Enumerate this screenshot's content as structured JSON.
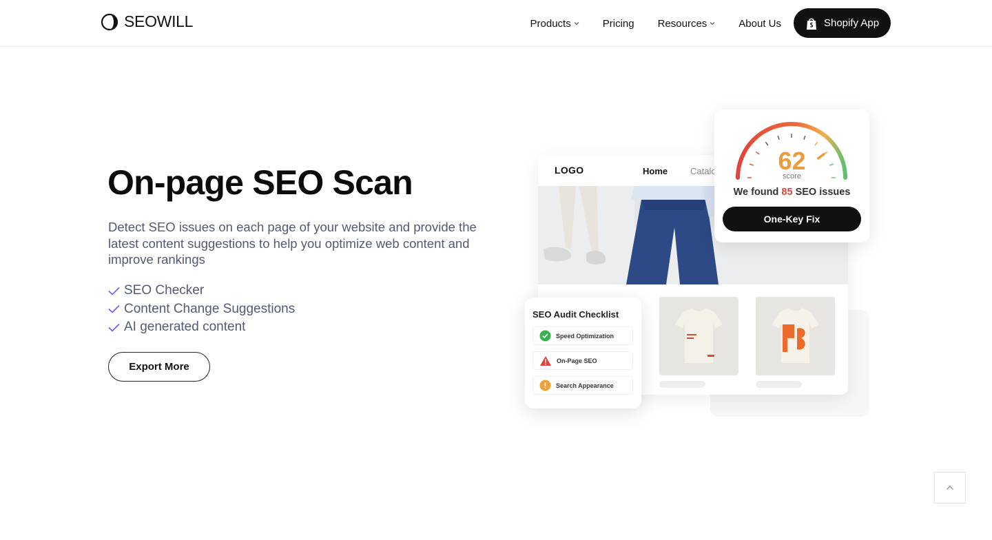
{
  "header": {
    "brand": "SEOWILL",
    "nav": [
      {
        "label": "Products",
        "has_dropdown": true
      },
      {
        "label": "Pricing",
        "has_dropdown": false
      },
      {
        "label": "Resources",
        "has_dropdown": true
      },
      {
        "label": "About Us",
        "has_dropdown": false
      }
    ],
    "cta": {
      "label": "Shopify App",
      "icon": "shopify-bag-icon"
    }
  },
  "hero": {
    "title": "On-page SEO Scan",
    "description": "Detect SEO issues on each page of your website and provide the latest content suggestions to help you optimize web content and improve rankings",
    "features": [
      "SEO Checker",
      "Content Change Suggestions",
      "AI generated content"
    ],
    "button": "Export More"
  },
  "illustration": {
    "shop": {
      "logo": "LOGO",
      "nav_active": "Home",
      "nav_other": "Catalo"
    },
    "score": {
      "value": "62",
      "label": "score",
      "found_prefix": "We found",
      "found_count": "85",
      "found_suffix": "SEO issues",
      "fix_button": "One-Key Fix",
      "gauge_level": 0.62
    },
    "audit": {
      "title": "SEO Audit Checklist",
      "items": [
        {
          "label": "Speed Optimization",
          "status": "pass",
          "icon": "check-circle-icon",
          "color": "#35b24a"
        },
        {
          "label": "On-Page SEO",
          "status": "error",
          "icon": "warning-triangle-icon",
          "color": "#e0443a"
        },
        {
          "label": "Search Appearance",
          "status": "warning",
          "icon": "exclamation-circle-icon",
          "color": "#f0a23a"
        }
      ]
    }
  },
  "colors": {
    "accent_check": "#6b5cff",
    "text_muted": "#525a74",
    "dark": "#111111"
  },
  "scroll_top_icon": "chevron-up-icon"
}
